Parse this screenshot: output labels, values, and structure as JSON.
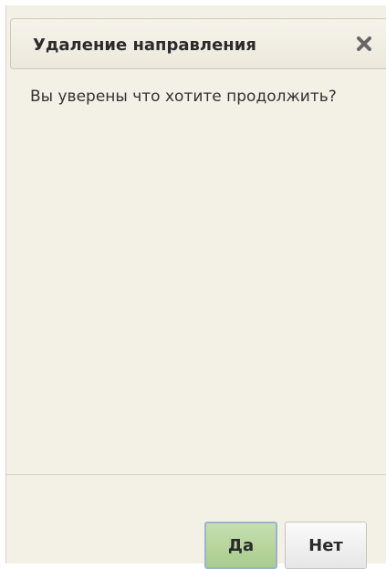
{
  "dialog": {
    "title": "Удаление направления",
    "close_icon": "close-icon",
    "message": "Вы уверены что хотите продолжить?",
    "buttons": {
      "yes_label": "Да",
      "no_label": "Нет"
    }
  },
  "colors": {
    "dialog_background": "#f3f0e6",
    "yes_button": "#b8d89c",
    "yes_button_focus_border": "#9ab4d0",
    "no_button": "#f0f0f0",
    "close_icon": "#666666"
  }
}
